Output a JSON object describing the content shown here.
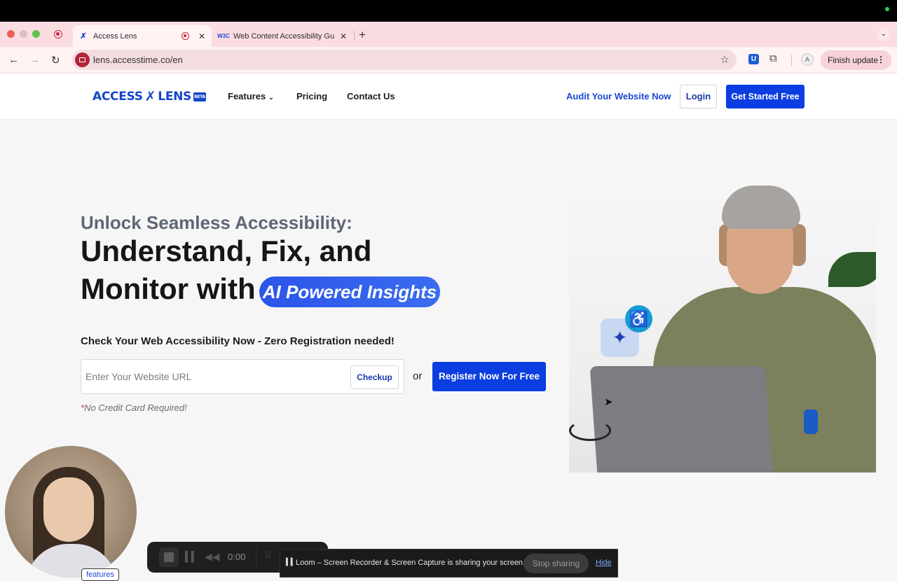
{
  "browser": {
    "tabs": [
      {
        "title": "Access Lens",
        "active": true,
        "favicon": "access-lens-favicon"
      },
      {
        "title": "Web Content Accessibility Gu",
        "active": false,
        "favicon": "w3c-favicon"
      }
    ],
    "url": "lens.accesstime.co/en",
    "profile_initial": "A",
    "finish_update_label": "Finish update",
    "bitwarden_letter": "U"
  },
  "site": {
    "logo": {
      "word1": "ACCESS",
      "word2": "LENS",
      "badge": "BETA"
    },
    "nav": {
      "features": "Features",
      "pricing": "Pricing",
      "contact": "Contact Us"
    },
    "audit_link": "Audit Your Website Now",
    "login_label": "Login",
    "get_started_label": "Get Started Free"
  },
  "hero": {
    "subheading": "Unlock Seamless Accessibility:",
    "line1": "Understand, Fix, and",
    "line2": "Monitor with",
    "pill": "AI Powered Insights",
    "check_heading": "Check Your Web Accessibility Now - Zero Registration needed!",
    "url_placeholder": "Enter Your Website URL",
    "checkup_label": "Checkup",
    "or_label": "or",
    "register_label": "Register Now For Free",
    "no_cc_asterisk": "*",
    "no_cc_text": "No Credit Card Required!"
  },
  "loom": {
    "timer": "0:00",
    "features_tag": "features",
    "share_message": "Loom – Screen Recorder & Screen Capture is sharing your screen.",
    "stop_sharing_label": "Stop sharing",
    "hide_label": "Hide"
  },
  "colors": {
    "brand_blue": "#0b3ee0",
    "tab_strip_pink": "#fbdde1",
    "accent_cyan": "#169bd6"
  }
}
